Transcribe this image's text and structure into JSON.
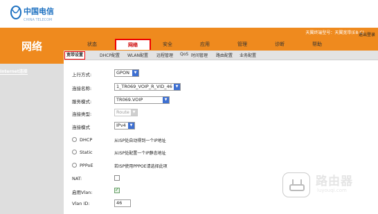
{
  "header": {
    "section_title": "网络",
    "model_text": "天翼终端型号：天翼宽带(E8-C)",
    "logout_label": "退出登录"
  },
  "tabs": [
    {
      "label": "状态"
    },
    {
      "label": "网络",
      "active": true
    },
    {
      "label": "安全"
    },
    {
      "label": "应用"
    },
    {
      "label": "管理"
    },
    {
      "label": "诊断"
    },
    {
      "label": "帮助"
    }
  ],
  "subnav": [
    {
      "label": "宽带设置",
      "active": true
    },
    {
      "label": "DHCP配置"
    },
    {
      "label": "WLAN配置"
    },
    {
      "label": "远程管理"
    },
    {
      "label": "QoS"
    },
    {
      "label": "时间管理"
    },
    {
      "label": "路由配置"
    },
    {
      "label": "业务配置"
    }
  ],
  "left_nav": {
    "item": "Internet连接"
  },
  "form": {
    "uplink": {
      "label": "上行方式:",
      "value": "GPON"
    },
    "conn_name": {
      "label": "连接名称:",
      "value": "1_TR069_VOIP_R_VID_46"
    },
    "service_mode": {
      "label": "服务模式:",
      "value": "TR069.VOIP"
    },
    "conn_type": {
      "label": "连接类型:",
      "value": "Route"
    },
    "conn_mode": {
      "label": "连接模式",
      "value": "IPv4"
    },
    "dhcp": {
      "label": "DHCP",
      "hint": "从ISP处自动得到一个IP地址"
    },
    "static": {
      "label": "Static",
      "hint": "从ISP处配置一个IP静态地址"
    },
    "pppoe": {
      "label": "PPPoE",
      "hint": "若ISP使用PPPOE请选择此项"
    },
    "nat": {
      "label": "NAT:"
    },
    "vlan_enable": {
      "label": "启用Vlan:"
    },
    "vlan_id": {
      "label": "Vlan ID:",
      "value": "46"
    }
  },
  "watermark": {
    "name": "路由器",
    "url": "luyouqi.com"
  },
  "colors": {
    "brand_orange": "#ef8a1e",
    "active_red": "#e00000",
    "select_arrow": "#3d6fd1"
  }
}
